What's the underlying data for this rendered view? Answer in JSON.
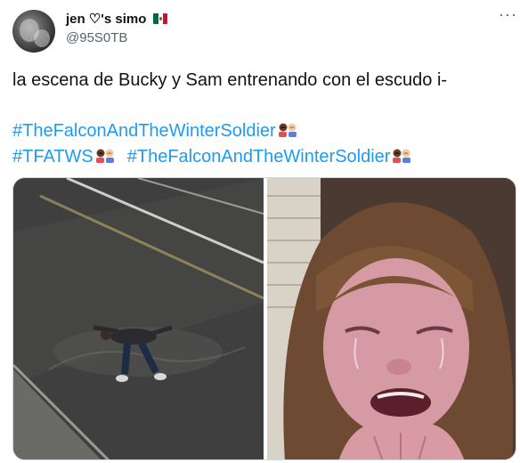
{
  "author": {
    "display_name": "jen ♡'s simo",
    "handle": "@95S0TB",
    "flag": "mexico-flag"
  },
  "more_label": "···",
  "tweet": {
    "text": "la escena de Bucky y Sam entrenando con el escudo i-",
    "hashtags": [
      "#TheFalconAndTheWinterSoldier",
      "#TFATWS",
      "#TheFalconAndTheWinterSoldier"
    ]
  },
  "media": {
    "left_photo": "photo-person-lying-on-wet-road",
    "right_photo": "photo-crying-person"
  },
  "colors": {
    "hashtag": "#1d9bf0",
    "text": "#0f1419",
    "secondary": "#536471"
  }
}
